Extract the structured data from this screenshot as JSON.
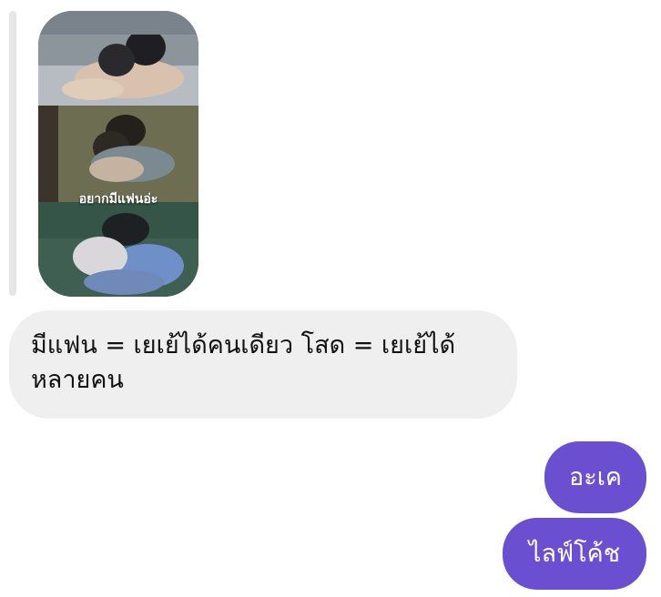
{
  "reply": {
    "media_caption": "อยากมีแฟนอ่ะ",
    "media_icon": "couple-in-bed-photo-icon"
  },
  "messages": [
    {
      "side": "incoming",
      "text": "มีแฟน = เยเย้ได้คนเดียว โสด = เยเย้ได้ หลายคน"
    },
    {
      "side": "outgoing",
      "text": "อะเค"
    },
    {
      "side": "outgoing",
      "text": "ไลฟ์โค้ช"
    }
  ],
  "colors": {
    "incoming_bubble": "#efefef",
    "outgoing_bubble": "#6a4fd0",
    "reply_bar": "#e6e6e6"
  }
}
